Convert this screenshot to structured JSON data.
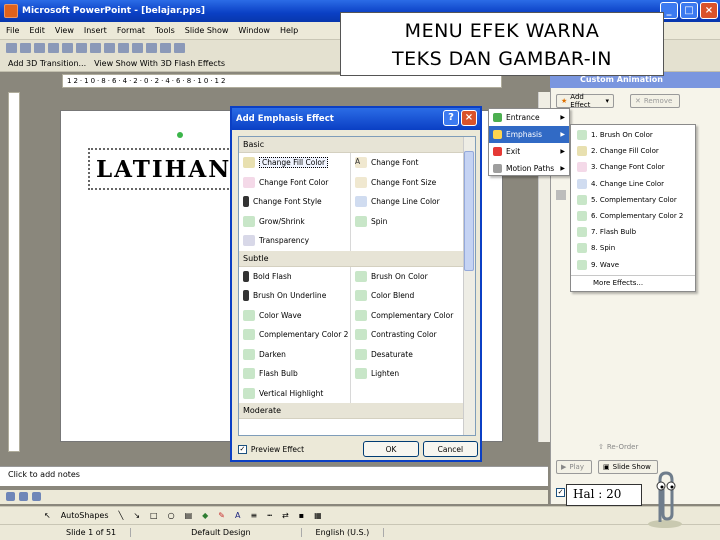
{
  "window": {
    "title": "Microsoft PowerPoint - [belajar.pps]"
  },
  "menubar": [
    "File",
    "Edit",
    "View",
    "Insert",
    "Format",
    "Tools",
    "Slide Show",
    "Window",
    "Help"
  ],
  "toolbar2": [
    "Add 3D Transition...",
    "View Show With 3D Flash Effects"
  ],
  "ruler": "12·10·8·6·4·2·0·2·4·6·8·10·12",
  "caption": {
    "line1": "MENU EFEK WARNA",
    "line2": "TEKS DAN GAMBAR-IN"
  },
  "slide": {
    "title": "LATIHAN 0"
  },
  "dialog": {
    "title": "Add Emphasis Effect",
    "sections": [
      {
        "name": "Basic",
        "items": [
          "Change Fill Color",
          "Change Font",
          "Change Font Color",
          "Change Font Size",
          "Change Font Style",
          "Change Line Color",
          "Grow/Shrink",
          "Spin",
          "Transparency"
        ]
      },
      {
        "name": "Subtle",
        "items": [
          "Bold Flash",
          "Brush On Color",
          "Brush On Underline",
          "Color Blend",
          "Color Wave",
          "Complementary Color",
          "Complementary Color 2",
          "Contrasting Color",
          "Darken",
          "Desaturate",
          "Flash Bulb",
          "Lighten",
          "Vertical Highlight"
        ]
      },
      {
        "name": "Moderate",
        "items": []
      }
    ],
    "preview_label": "Preview Effect",
    "ok": "OK",
    "cancel": "Cancel"
  },
  "task_pane": {
    "title": "Custom Animation",
    "add_effect": "Add Effect",
    "remove": "Remove",
    "re_order": "Re-Order",
    "play": "Play",
    "slide_show": "Slide Show"
  },
  "effect_menu": [
    {
      "label": "Entrance"
    },
    {
      "label": "Emphasis",
      "highlighted": true
    },
    {
      "label": "Exit"
    },
    {
      "label": "Motion Paths"
    }
  ],
  "emphasis_menu": [
    "1. Brush On Color",
    "2. Change Fill Color",
    "3. Change Font Color",
    "4. Change Line Color",
    "5. Complementary Color",
    "6. Complementary Color 2",
    "7. Flash Bulb",
    "8. Spin",
    "9. Wave",
    "More Effects..."
  ],
  "notes": {
    "placeholder": "Click to add notes"
  },
  "drawbar": {
    "autoshapes": "AutoShapes"
  },
  "status": {
    "slide": "Slide 1 of 51",
    "design": "Default Design",
    "language": "English (U.S.)"
  },
  "page_label": "Hal : 20",
  "colors": {
    "titlebar": "#0a3fc4",
    "highlight": "#316ac5",
    "accent": "#d9532b"
  }
}
